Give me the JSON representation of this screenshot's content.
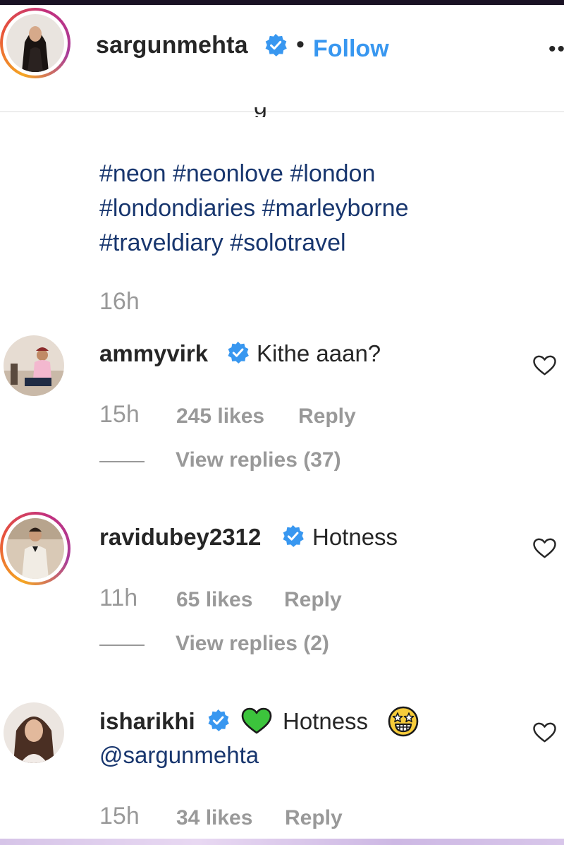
{
  "post": {
    "username": "sargunmehta",
    "separator": "•",
    "follow_label": "Follow",
    "more_icon": "more-options-icon",
    "caption_fragment": "g",
    "hashtag_lines": [
      "#neon #neonlove #london",
      "#londondiaries #marleyborne",
      "#traveldiary #solotravel"
    ],
    "time_ago": "16h"
  },
  "comments": [
    {
      "username": "ammyvirk",
      "text": "Kithe aaan?",
      "time": "15h",
      "likes": "245 likes",
      "reply_label": "Reply",
      "view_replies": "View replies (37)"
    },
    {
      "username": "ravidubey2312",
      "text": "Hotness",
      "time": "11h",
      "likes": "65 likes",
      "reply_label": "Reply",
      "view_replies": "View replies (2)"
    },
    {
      "username": "isharikhi",
      "text": "Hotness",
      "mention": "@sargunmehta",
      "time": "15h",
      "likes": "34 likes",
      "reply_label": "Reply",
      "emojis": [
        "green-heart-emoji",
        "star-struck-emoji"
      ]
    }
  ],
  "colors": {
    "link_blue": "#3897f0",
    "hashtag_navy": "#18366e",
    "meta_gray": "#999999",
    "text_dark": "#262626",
    "verified_blue": "#3897f0"
  }
}
